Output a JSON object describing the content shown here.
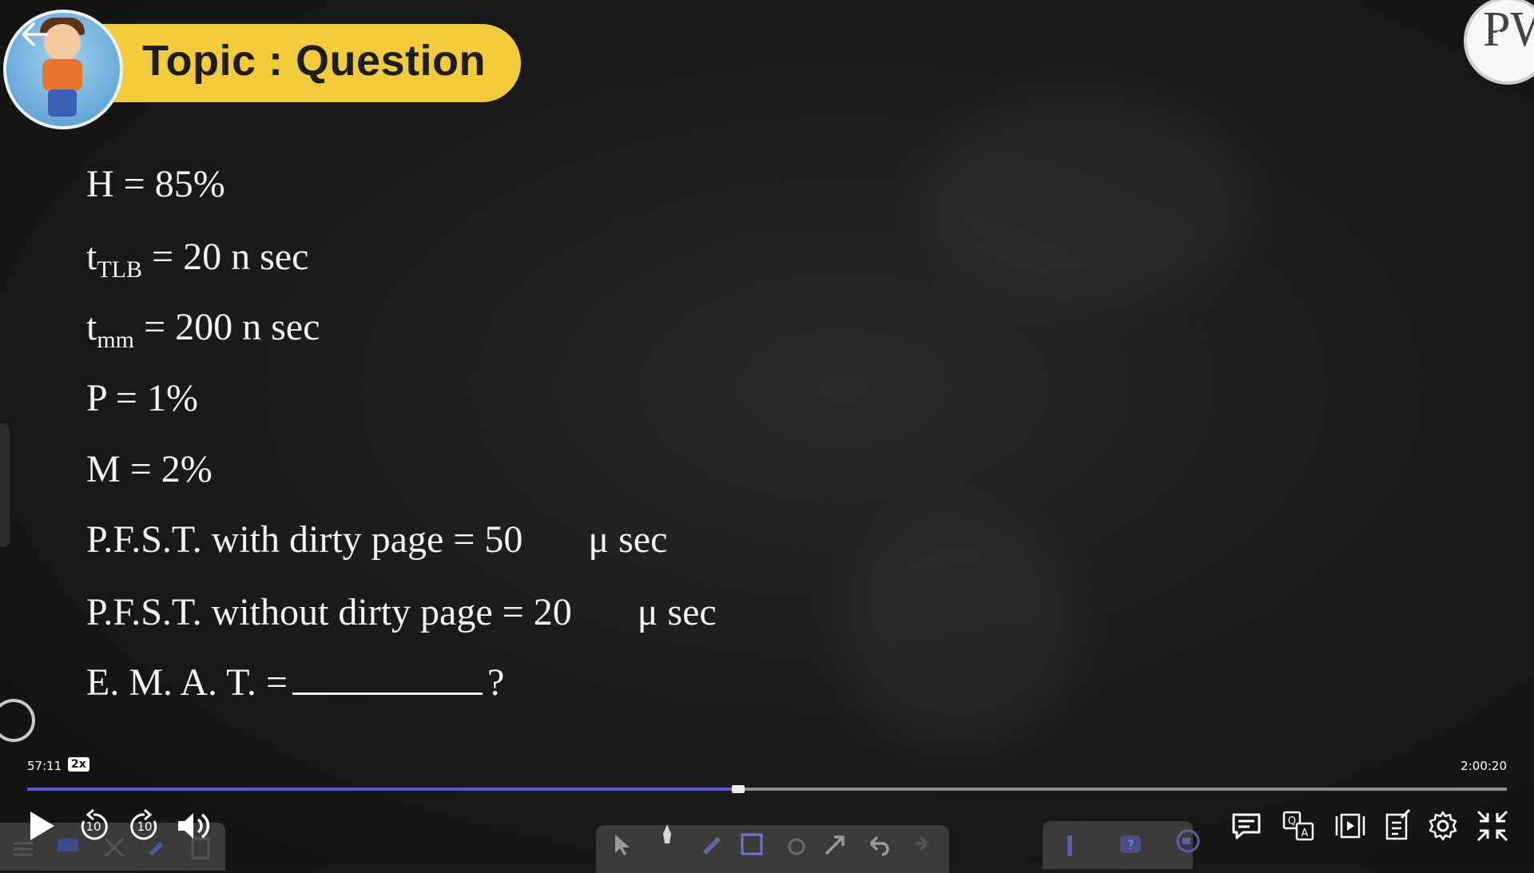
{
  "banner": {
    "title": "Topic : Question"
  },
  "logo": {
    "text": "PW"
  },
  "question": {
    "lines": [
      {
        "lhs": "H",
        "rhs": "= 85%"
      },
      {
        "lhs": "t",
        "sub": "TLB",
        "rhs": "= 20 n sec"
      },
      {
        "lhs": "t",
        "sub": "mm",
        "rhs": "= 200 n sec"
      },
      {
        "lhs": "P",
        "rhs": "= 1%"
      },
      {
        "lhs": "M",
        "rhs": "= 2%"
      },
      {
        "lhs": "P.F.S.T. with dirty page = 50",
        "unit": "μ sec"
      },
      {
        "lhs": "P.F.S.T. without dirty page = 20",
        "unit": "μ sec"
      },
      {
        "lhs": "E. M. A. T. =",
        "tail": "?"
      }
    ]
  },
  "player": {
    "current_time": "57:11",
    "speed": "2x",
    "total_time": "2:00:20",
    "progress": 0.476,
    "rewind_label": "10",
    "forward_label": "10"
  },
  "icons": {
    "back": "arrow-left-icon",
    "menu": "more-vertical-icon",
    "play": "play-icon",
    "rewind": "rewind-10-icon",
    "forward": "forward-10-icon",
    "volume": "volume-icon",
    "chat": "chat-icon",
    "translate": "translate-icon",
    "playlist": "playlist-icon",
    "notes": "notes-icon",
    "settings": "gear-icon",
    "fullscreen_exit": "minimize-icon"
  },
  "colors": {
    "banner": "#f1cb3b",
    "progress": "#5b56d9"
  }
}
